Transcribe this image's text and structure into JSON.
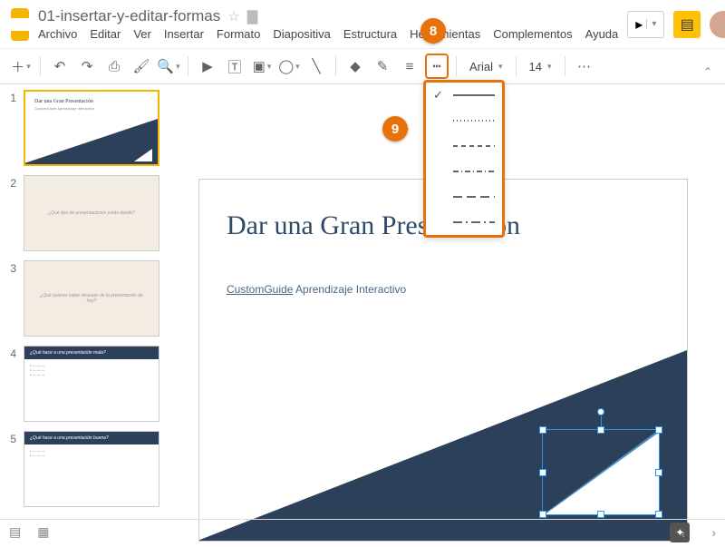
{
  "doc_title": "01-insertar-y-editar-formas",
  "menu": [
    "Archivo",
    "Editar",
    "Ver",
    "Insertar",
    "Formato",
    "Diapositiva",
    "Estructura",
    "Herramientas",
    "Complementos",
    "Ayuda"
  ],
  "toolbar": {
    "font_name": "Arial",
    "font_size": "14"
  },
  "slides": [
    {
      "num": "1",
      "title": "Dar una Gran Presentación",
      "sub": "CustomGuide Aprendizaje Interactivo",
      "type": "title"
    },
    {
      "num": "2",
      "title": "¿Qué tipo de presentaciones estás dando?",
      "type": "question"
    },
    {
      "num": "3",
      "title": "¿Qué quieres saber después de la presentación de hoy?",
      "type": "question"
    },
    {
      "num": "4",
      "title": "¿Qué hace a una presentación mala?",
      "type": "content"
    },
    {
      "num": "5",
      "title": "¿Qué hace a una presentación buena?",
      "type": "content"
    }
  ],
  "main_slide": {
    "title": "Dar una Gran Presentación",
    "brand": "CustomGuide",
    "subtitle_rest": " Aprendizaje Interactivo"
  },
  "callouts": {
    "c8": "8",
    "c9": "9"
  },
  "line_dash_options": [
    "solid",
    "dotted",
    "dashed",
    "dash-dot",
    "long-dash",
    "long-dash-dot"
  ]
}
